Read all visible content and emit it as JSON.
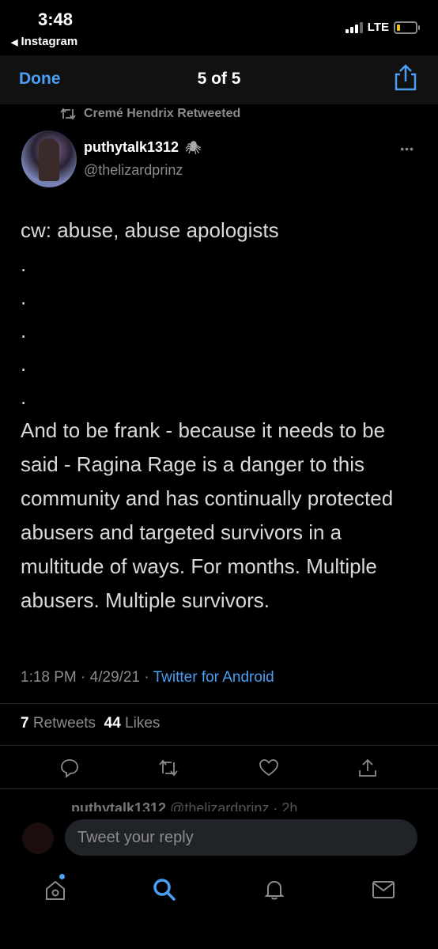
{
  "status_bar": {
    "time": "3:48",
    "back_app": "Instagram",
    "network": "LTE",
    "battery_level": 0.15
  },
  "viewer": {
    "done_label": "Done",
    "counter": "5 of 5",
    "share_icon": "share-icon"
  },
  "retweet_line": {
    "icon": "retweet-icon",
    "text": "Cremé Hendrix Retweeted"
  },
  "tweet": {
    "display_name": "puthytalk1312",
    "emoji": "🕷",
    "handle": "@thelizardprinz",
    "more_icon": "more-dots-icon",
    "first_line": "cw: abuse, abuse apologists",
    "dots": [
      ".",
      ".",
      ".",
      ".",
      "."
    ],
    "body": "And to be frank - because it needs to be said - Ragina Rage is a danger to this community and has continually protected abusers and targeted survivors in a multitude of ways. For months. Multiple abusers. Multiple survivors.",
    "time": "1:18 PM",
    "date": "4/29/21",
    "source": "Twitter for Android",
    "retweets_count": "7",
    "retweets_label": "Retweets",
    "likes_count": "44",
    "likes_label": "Likes"
  },
  "action_icons": [
    "reply-icon",
    "retweet-icon",
    "like-icon",
    "share-icon"
  ],
  "next_tweet": {
    "display_name": "puthytalk1312",
    "handle_time": "@thelizardprinz · 2h"
  },
  "reply": {
    "placeholder": "Tweet your reply"
  },
  "bottom_nav": [
    "home-icon",
    "search-icon",
    "notifications-icon",
    "messages-icon"
  ],
  "colors": {
    "accent": "#4a9ff5",
    "background": "#000000",
    "muted": "#8b8b8b"
  }
}
